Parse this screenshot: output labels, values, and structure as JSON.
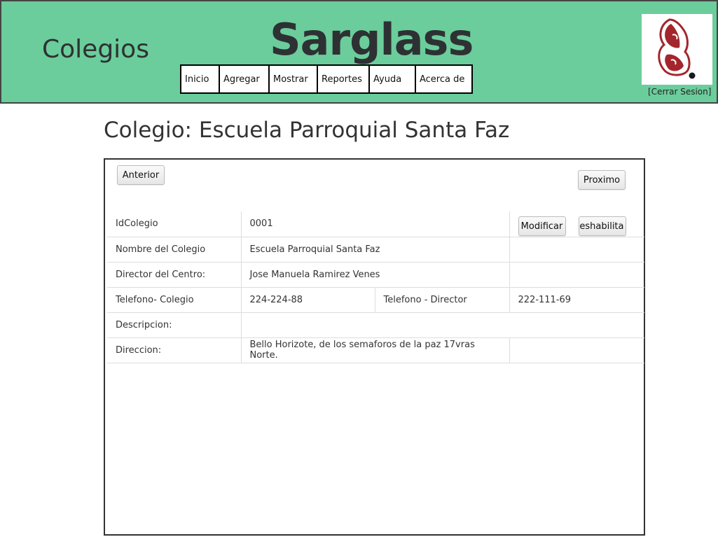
{
  "header": {
    "section_title": "Colegios",
    "brand": "Sarglass",
    "nav": [
      "Inicio",
      "Agregar",
      "Mostrar",
      "Reportes",
      "Ayuda",
      "Acerca de"
    ],
    "logout": "[Cerrar Sesion]"
  },
  "page": {
    "title": "Colegio: Escuela Parroquial Santa Faz"
  },
  "panel": {
    "prev_label": "Anterior",
    "next_label": "Proximo",
    "modify_label": "Modificar",
    "disable_label": "Deshabilita",
    "fields": {
      "id_label": "IdColegio",
      "id_value": "0001",
      "name_label": "Nombre del Colegio",
      "name_value": "Escuela Parroquial Santa Faz",
      "director_label": "Director del Centro:",
      "director_value": "Jose Manuela Ramirez Venes",
      "phone_school_label": "Telefono- Colegio",
      "phone_school_value": "224-224-88",
      "phone_director_label": "Telefono - Director",
      "phone_director_value": "222-111-69",
      "description_label": "Descripcion:",
      "description_value": "",
      "address_label": "Direccion:",
      "address_value": "Bello Horizote, de los semaforos de la paz 17vras Norte."
    }
  },
  "colors": {
    "header_bg": "#6bcd9b",
    "logo_red": "#a3262c"
  }
}
